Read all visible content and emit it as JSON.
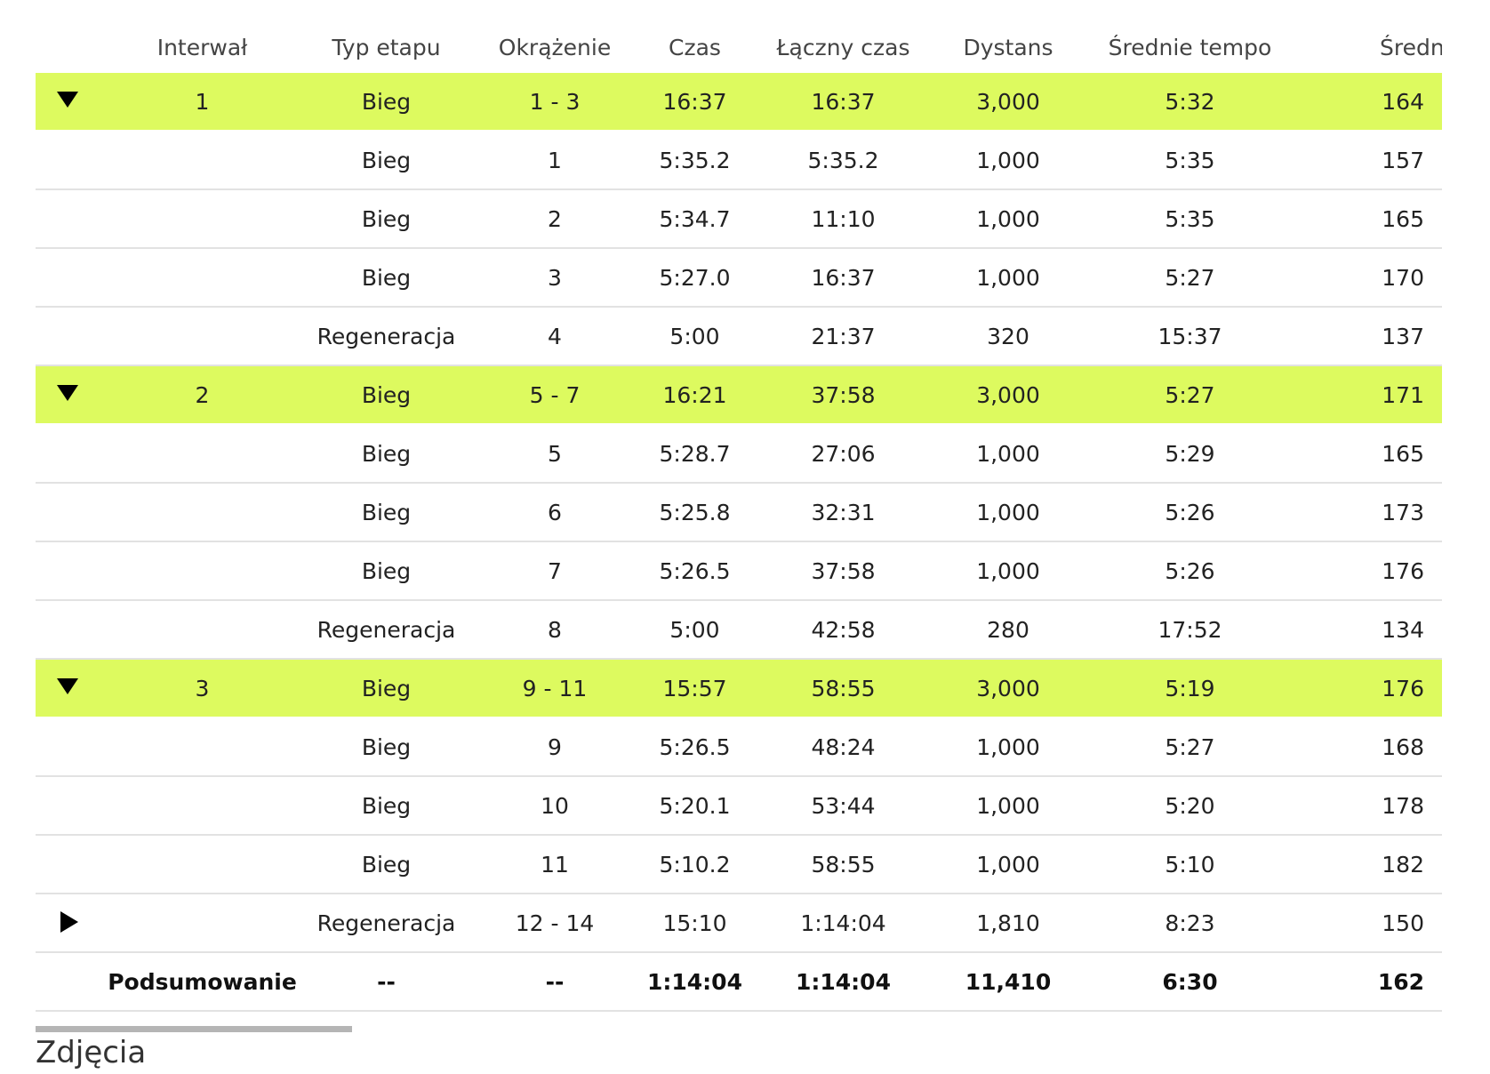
{
  "table": {
    "headers": {
      "interval": "Interwał",
      "type": "Typ etapu",
      "lap": "Okrążenie",
      "time": "Czas",
      "total_time": "Łączny czas",
      "distance": "Dystans",
      "avg_pace": "Średnie tempo",
      "avg_hr": "Średnie tętno"
    },
    "rows": [
      {
        "kind": "group",
        "toggle": "down",
        "interval": "1",
        "type": "Bieg",
        "lap": "1 - 3",
        "time": "16:37",
        "total_time": "16:37",
        "distance": "3,000",
        "avg_pace": "5:32",
        "avg_hr": "164"
      },
      {
        "kind": "lap",
        "toggle": "",
        "interval": "",
        "type": "Bieg",
        "lap": "1",
        "time": "5:35.2",
        "total_time": "5:35.2",
        "distance": "1,000",
        "avg_pace": "5:35",
        "avg_hr": "157"
      },
      {
        "kind": "lap",
        "toggle": "",
        "interval": "",
        "type": "Bieg",
        "lap": "2",
        "time": "5:34.7",
        "total_time": "11:10",
        "distance": "1,000",
        "avg_pace": "5:35",
        "avg_hr": "165"
      },
      {
        "kind": "lap",
        "toggle": "",
        "interval": "",
        "type": "Bieg",
        "lap": "3",
        "time": "5:27.0",
        "total_time": "16:37",
        "distance": "1,000",
        "avg_pace": "5:27",
        "avg_hr": "170"
      },
      {
        "kind": "lap",
        "toggle": "",
        "interval": "",
        "type": "Regeneracja",
        "lap": "4",
        "time": "5:00",
        "total_time": "21:37",
        "distance": "320",
        "avg_pace": "15:37",
        "avg_hr": "137"
      },
      {
        "kind": "group",
        "toggle": "down",
        "interval": "2",
        "type": "Bieg",
        "lap": "5 - 7",
        "time": "16:21",
        "total_time": "37:58",
        "distance": "3,000",
        "avg_pace": "5:27",
        "avg_hr": "171"
      },
      {
        "kind": "lap",
        "toggle": "",
        "interval": "",
        "type": "Bieg",
        "lap": "5",
        "time": "5:28.7",
        "total_time": "27:06",
        "distance": "1,000",
        "avg_pace": "5:29",
        "avg_hr": "165"
      },
      {
        "kind": "lap",
        "toggle": "",
        "interval": "",
        "type": "Bieg",
        "lap": "6",
        "time": "5:25.8",
        "total_time": "32:31",
        "distance": "1,000",
        "avg_pace": "5:26",
        "avg_hr": "173"
      },
      {
        "kind": "lap",
        "toggle": "",
        "interval": "",
        "type": "Bieg",
        "lap": "7",
        "time": "5:26.5",
        "total_time": "37:58",
        "distance": "1,000",
        "avg_pace": "5:26",
        "avg_hr": "176"
      },
      {
        "kind": "lap",
        "toggle": "",
        "interval": "",
        "type": "Regeneracja",
        "lap": "8",
        "time": "5:00",
        "total_time": "42:58",
        "distance": "280",
        "avg_pace": "17:52",
        "avg_hr": "134"
      },
      {
        "kind": "group",
        "toggle": "down",
        "interval": "3",
        "type": "Bieg",
        "lap": "9 - 11",
        "time": "15:57",
        "total_time": "58:55",
        "distance": "3,000",
        "avg_pace": "5:19",
        "avg_hr": "176"
      },
      {
        "kind": "lap",
        "toggle": "",
        "interval": "",
        "type": "Bieg",
        "lap": "9",
        "time": "5:26.5",
        "total_time": "48:24",
        "distance": "1,000",
        "avg_pace": "5:27",
        "avg_hr": "168"
      },
      {
        "kind": "lap",
        "toggle": "",
        "interval": "",
        "type": "Bieg",
        "lap": "10",
        "time": "5:20.1",
        "total_time": "53:44",
        "distance": "1,000",
        "avg_pace": "5:20",
        "avg_hr": "178"
      },
      {
        "kind": "lap",
        "toggle": "",
        "interval": "",
        "type": "Bieg",
        "lap": "11",
        "time": "5:10.2",
        "total_time": "58:55",
        "distance": "1,000",
        "avg_pace": "5:10",
        "avg_hr": "182"
      },
      {
        "kind": "collapsed",
        "toggle": "right",
        "interval": "",
        "type": "Regeneracja",
        "lap": "12 - 14",
        "time": "15:10",
        "total_time": "1:14:04",
        "distance": "1,810",
        "avg_pace": "8:23",
        "avg_hr": "150"
      }
    ],
    "summary": {
      "interval": "Podsumowanie",
      "type": "--",
      "lap": "--",
      "time": "1:14:04",
      "total_time": "1:14:04",
      "distance": "11,410",
      "avg_pace": "6:30",
      "avg_hr": "162"
    }
  },
  "photos_section": {
    "title": "Zdjęcia"
  },
  "colors": {
    "group_row_background": "#ddfa5f",
    "row_divider": "#e2e2e2",
    "scrollbar": "#b5b5b5"
  },
  "icons": {
    "expanded": "triangle-down-icon",
    "collapsed": "triangle-right-icon"
  }
}
